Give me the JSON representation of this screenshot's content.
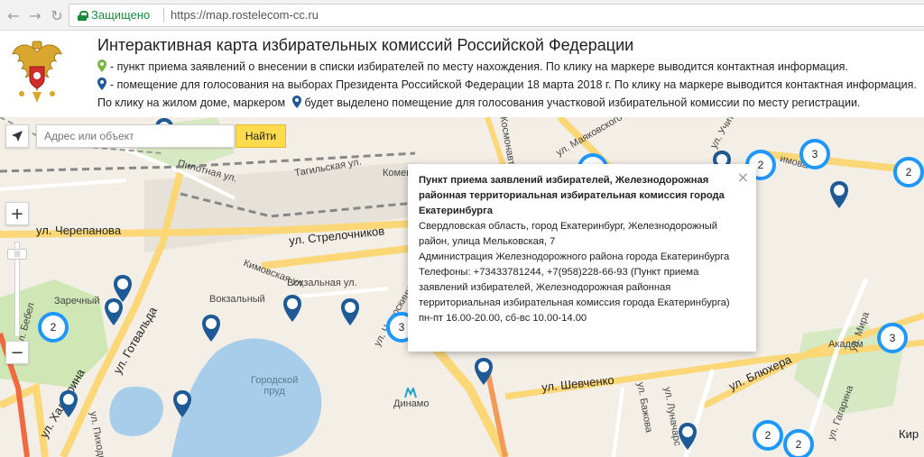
{
  "browser": {
    "back_icon": "back-arrow-icon",
    "forward_icon": "forward-arrow-icon",
    "reload_icon": "reload-icon",
    "secure_label": "Защищено",
    "url": "https://map.rostelecom-cc.ru"
  },
  "header": {
    "title": "Интерактивная карта избирательных комиссий Российской Федерации",
    "legend_green": "- пункт приема заявлений о внесении в списки избирателей по месту нахождения. По клику на маркере выводится контактная информация.",
    "legend_blue": "- помещение для голосования на выборах Президента Российской Федерации 18 марта 2018 г. По клику на маркере выводится контактная информация.",
    "hint_before": "По клику на жилом доме, маркером",
    "hint_after": "будет выделено помещение для голосования участковой избирательной комиссии по месту регистрации.",
    "colors": {
      "green_marker": "#7ab648",
      "blue_marker": "#1e5a96"
    }
  },
  "map": {
    "search_placeholder": "Адрес или объект",
    "search_button": "Найти",
    "zoom_in": "+",
    "zoom_out": "−",
    "streets": {
      "cheryapanova": "ул. Черепанова",
      "strelochnikov": "ул. Стрелочников",
      "gotvalda": "ул. Готвальда",
      "khalturina": "ул. Халтурина",
      "shevchenko": "ул. Шевченко",
      "blyukhera": "ул. Блюхера",
      "gagarina": "ул. Гагарина",
      "mira": "ул. Мира",
      "akadem": "Академ",
      "mayakovskogo": "ул. Маяковского",
      "kosmonavtov": "Космонавтов",
      "tagilskaya": "Тагильская ул.",
      "pilotnaya": "Пилотная ул.",
      "vokzalny": "Вокзальный",
      "zarechny": "Заречный",
      "kimovskaya": "Кимовская ул.",
      "vozvalnaya": "Вокзальная ул.",
      "chelyuskintsev": "ул. Челюскинцев",
      "gorodskoy_prud": "Городской пруд",
      "dinamo": "Динамо",
      "komen": "Коменд",
      "kir": "Кир",
      "bebel": "ул. Бебел",
      "uchit": "ул. Учит",
      "mirovaya": "имова",
      "bazhova": "ул. Бажова",
      "lunacharskogo": "ул. Луначарс",
      "pikhodnyi": "ул. Пиходн"
    },
    "clusters": [
      "2",
      "3",
      "2",
      "3",
      "2",
      "3",
      "2",
      "2"
    ],
    "balloon": {
      "title": "Пункт приема заявлений избирателей, Железнодорожная районная территориальная избирательная комиссия города Екатеринбурга",
      "address": "Свердловская область, город Екатеринбург, Железнодорожный район, улица Мельковская, 7",
      "org": "Администрация Железнодорожного района города Екатеринбурга",
      "phones": "Телефоны: +73433781244, +7(958)228-66-93 (Пункт приема заявлений избирателей, Железнодорожная районная территориальная избирательная комиссия города Екатеринбурга)",
      "hours": "пн-пт 16.00-20.00, сб-вс 10.00-14.00",
      "close": "×"
    }
  }
}
